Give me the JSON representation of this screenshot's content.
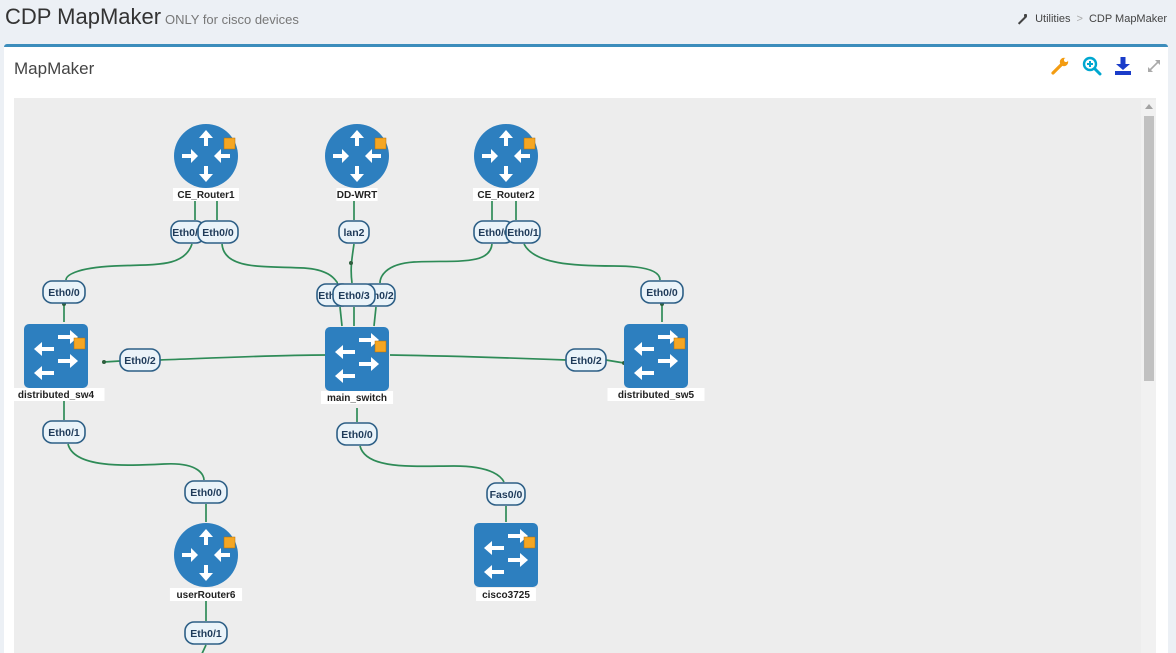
{
  "header": {
    "title": "CDP MapMaker",
    "subtitle": "ONLY for cisco devices",
    "breadcrumb": [
      "Utilities",
      "CDP MapMaker"
    ]
  },
  "box": {
    "title": "MapMaker",
    "tools": [
      "wrench-icon",
      "zoom-in-icon",
      "download-icon",
      "expand-icon"
    ]
  },
  "colors": {
    "accent": "#3c8dbc",
    "node": "#2d7fbf",
    "status_badge": "#f5a623",
    "link": "#2e8b57",
    "port_fill": "#eaf3f9",
    "port_border": "#2d5f86"
  },
  "map": {
    "nodes": [
      {
        "id": "ce1",
        "label": "CE_Router1",
        "type": "router"
      },
      {
        "id": "ddwrt",
        "label": "DD-WRT",
        "type": "router"
      },
      {
        "id": "ce2",
        "label": "CE_Router2",
        "type": "router"
      },
      {
        "id": "sw4",
        "label": "distributed_sw4",
        "type": "switch"
      },
      {
        "id": "main",
        "label": "main_switch",
        "type": "switch"
      },
      {
        "id": "sw5",
        "label": "distributed_sw5",
        "type": "switch"
      },
      {
        "id": "ur6",
        "label": "userRouter6",
        "type": "router"
      },
      {
        "id": "c3725",
        "label": "cisco3725",
        "type": "switch"
      }
    ],
    "ports": [
      {
        "id": "p1",
        "text": "Eth0/1"
      },
      {
        "id": "p2",
        "text": "Eth0/0"
      },
      {
        "id": "p3",
        "text": "lan2"
      },
      {
        "id": "p4",
        "text": "Eth0/0"
      },
      {
        "id": "p5",
        "text": "Eth0/1"
      },
      {
        "id": "p6",
        "text": "Eth0/0"
      },
      {
        "id": "p7",
        "text": "Eth0/1"
      },
      {
        "id": "p8",
        "text": "Eth0/2"
      },
      {
        "id": "p9",
        "text": "Eth0/3"
      },
      {
        "id": "p10",
        "text": "Eth0/0"
      },
      {
        "id": "p11",
        "text": "Eth0/2"
      },
      {
        "id": "p12",
        "text": "Eth0/2"
      },
      {
        "id": "p13",
        "text": "Eth0/1"
      },
      {
        "id": "p14",
        "text": "Eth0/0"
      },
      {
        "id": "p15",
        "text": "Eth0/0"
      },
      {
        "id": "p16",
        "text": "Fas0/0"
      },
      {
        "id": "p17",
        "text": "Eth0/1"
      }
    ]
  }
}
